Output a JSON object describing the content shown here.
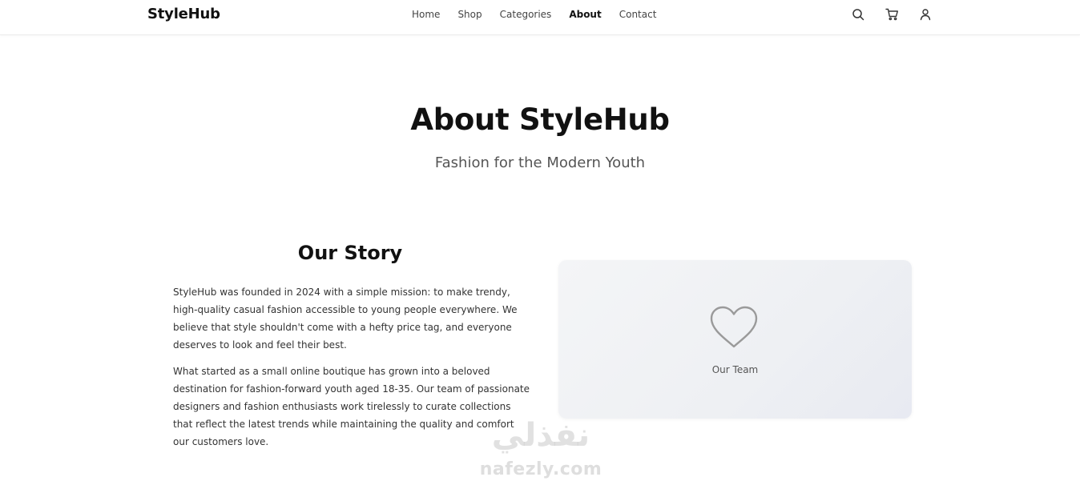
{
  "header": {
    "logo": "StyleHub",
    "nav": [
      {
        "label": "Home",
        "active": false
      },
      {
        "label": "Shop",
        "active": false
      },
      {
        "label": "Categories",
        "active": false
      },
      {
        "label": "About",
        "active": true
      },
      {
        "label": "Contact",
        "active": false
      }
    ],
    "icons": [
      "search-icon",
      "cart-icon",
      "user-icon"
    ]
  },
  "hero": {
    "title": "About StyleHub",
    "subtitle": "Fashion for the Modern Youth"
  },
  "story": {
    "heading": "Our Story",
    "paragraphs": [
      "StyleHub was founded in 2024 with a simple mission: to make trendy, high-quality casual fashion accessible to young people everywhere. We believe that style shouldn't come with a hefty price tag, and everyone deserves to look and feel their best.",
      "What started as a small online boutique has grown into a beloved destination for fashion-forward youth aged 18-35. Our team of passionate designers and fashion enthusiasts work tirelessly to curate collections that reflect the latest trends while maintaining the quality and comfort our customers love."
    ]
  },
  "team_card": {
    "icon": "heart-icon",
    "label": "Our Team"
  },
  "watermark": {
    "arabic": "نفذلي",
    "latin": "nafezly.com"
  },
  "colors": {
    "text": "#111111",
    "muted": "#555555",
    "card_bg": "#f2f3f5"
  }
}
